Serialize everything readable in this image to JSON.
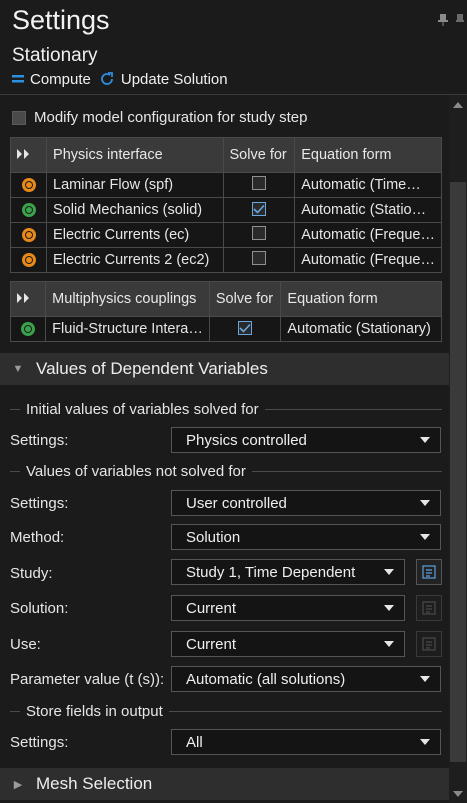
{
  "header": {
    "title": "Settings",
    "subtitle": "Stationary"
  },
  "toolbar": {
    "compute": "Compute",
    "update": "Update Solution"
  },
  "modify": {
    "label": "Modify model configuration for study step",
    "checked": false
  },
  "physics_table": {
    "headers": [
      "Physics interface",
      "Solve for",
      "Equation form"
    ],
    "rows": [
      {
        "status": "orange",
        "name": "Laminar Flow (spf)",
        "solve": false,
        "form": "Automatic (Time…"
      },
      {
        "status": "green",
        "name": "Solid Mechanics (solid)",
        "solve": true,
        "form": "Automatic (Statio…"
      },
      {
        "status": "orange",
        "name": "Electric Currents (ec)",
        "solve": false,
        "form": "Automatic (Freque…"
      },
      {
        "status": "orange",
        "name": "Electric Currents 2 (ec2)",
        "solve": false,
        "form": "Automatic (Freque…"
      }
    ]
  },
  "multiphysics_table": {
    "headers": [
      "Multiphysics couplings",
      "Solve for",
      "Equation form"
    ],
    "rows": [
      {
        "status": "green",
        "name": "Fluid-Structure Intera…",
        "solve": true,
        "form": "Automatic (Stationary)"
      }
    ]
  },
  "dependent": {
    "section_title": "Values of Dependent Variables",
    "group1": "Initial values of variables solved for",
    "settings1_label": "Settings:",
    "settings1_value": "Physics controlled",
    "group2": "Values of variables not solved for",
    "settings2_label": "Settings:",
    "settings2_value": "User controlled",
    "method_label": "Method:",
    "method_value": "Solution",
    "study_label": "Study:",
    "study_value": "Study 1, Time Dependent",
    "solution_label": "Solution:",
    "solution_value": "Current",
    "use_label": "Use:",
    "use_value": "Current",
    "param_label": "Parameter value (t (s)):",
    "param_value": "Automatic (all solutions)",
    "group3": "Store fields in output",
    "settings3_label": "Settings:",
    "settings3_value": "All"
  },
  "mesh": {
    "section_title": "Mesh Selection"
  },
  "colors": {
    "accent": "#2e8ee0",
    "status_orange": "#e88a1a",
    "status_green": "#3aa24a"
  }
}
